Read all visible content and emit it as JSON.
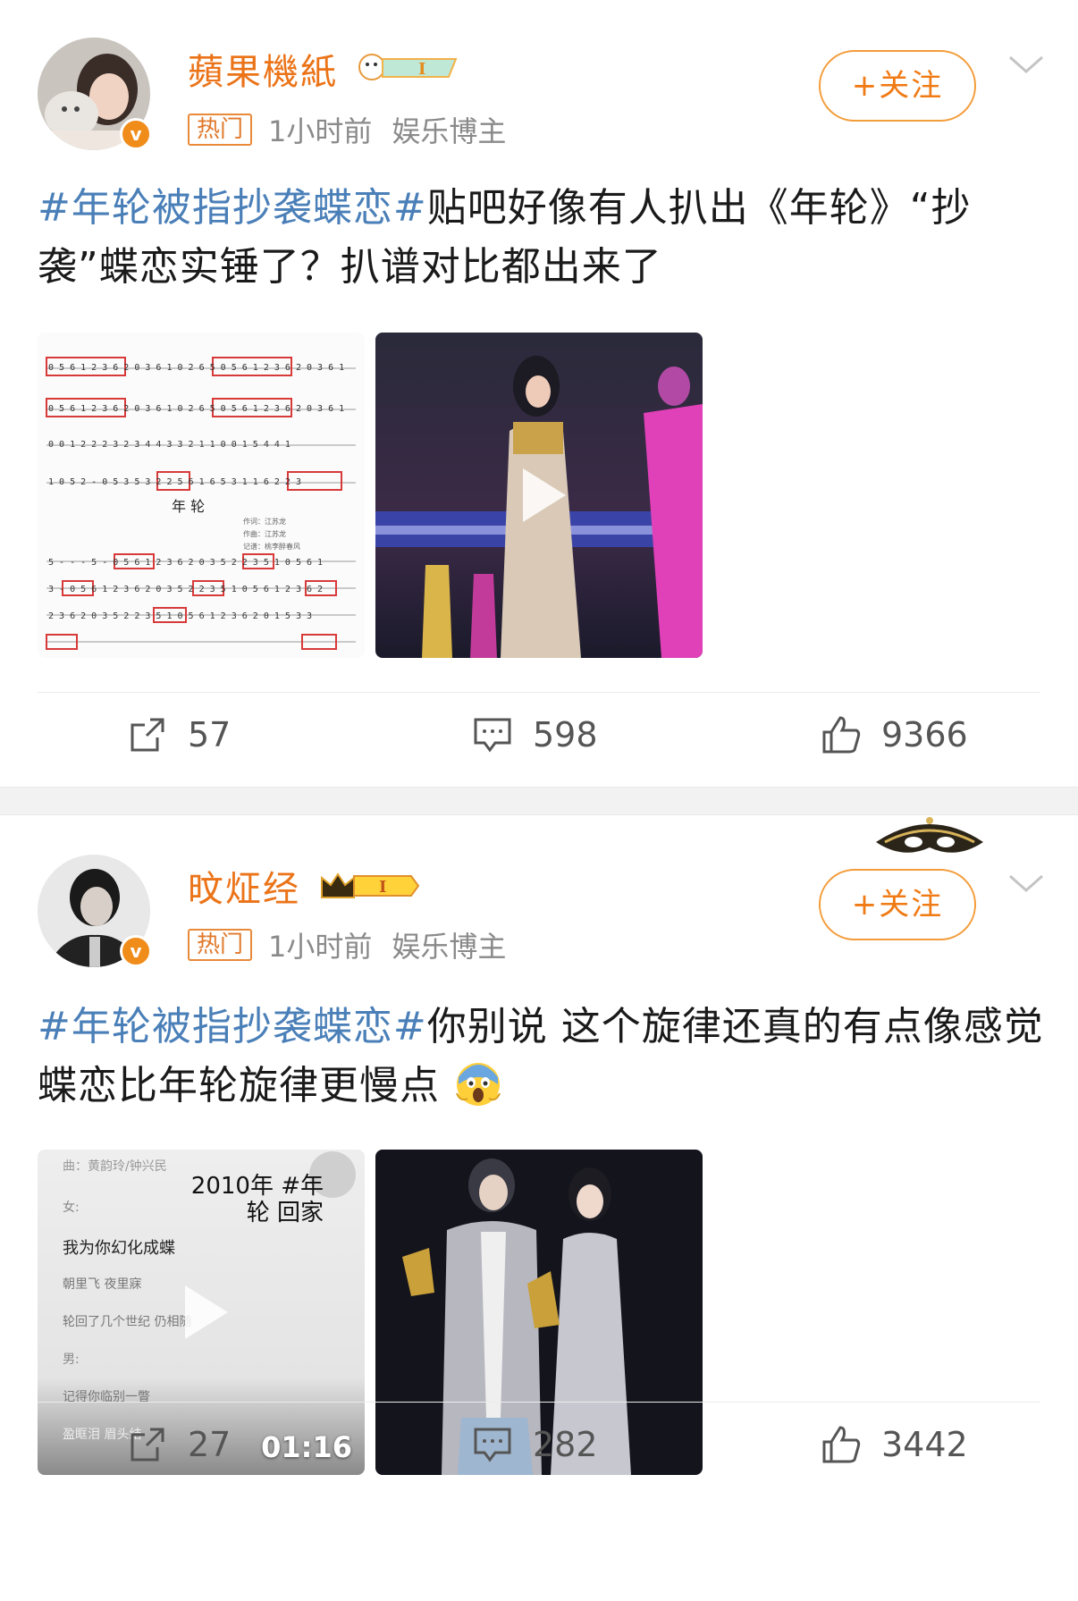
{
  "posts": [
    {
      "username": "蘋果機紙",
      "hot_label": "热门",
      "time": "1小时前",
      "role": "娱乐博主",
      "follow_label": "+关注",
      "hashtag": "#年轮被指抄袭蝶恋#",
      "text": "贴吧好像有人扒出《年轮》“抄袭”蝶恋实锤了？扒谱对比都出来了",
      "thumbnails": [
        {
          "type": "sheet-music",
          "title": "年 轮"
        },
        {
          "type": "video",
          "icon": "play-icon"
        }
      ],
      "actions": {
        "repost": "57",
        "comment": "598",
        "like": "9366"
      }
    },
    {
      "username": "旼炡经",
      "hot_label": "热门",
      "time": "1小时前",
      "role": "娱乐博主",
      "follow_label": "+关注",
      "hashtag": "#年轮被指抄袭蝶恋#",
      "text": "你别说 这个旋律还真的有点像感觉蝶恋比年轮旋律更慢点",
      "thumbnails": [
        {
          "type": "video",
          "icon": "play-icon",
          "overlay_title": "2010年 #年轮 回家",
          "lyric_lines": [
            "曲：黄韵玲/钟兴民",
            "女:",
            "我为你幻化成蝶",
            "朝里飞 夜里寐",
            "轮回了几个世纪 仍相随",
            "男:",
            "记得你临别一瞥",
            "盈眶泪 眉头结"
          ],
          "duration": "01:16"
        },
        {
          "type": "photo"
        }
      ],
      "actions": {
        "repost": "27",
        "comment": "282",
        "like": "3442"
      }
    }
  ],
  "colors": {
    "accent": "#eb7318",
    "hashtag": "#4a7fb8",
    "meta": "#8a8a8a"
  }
}
